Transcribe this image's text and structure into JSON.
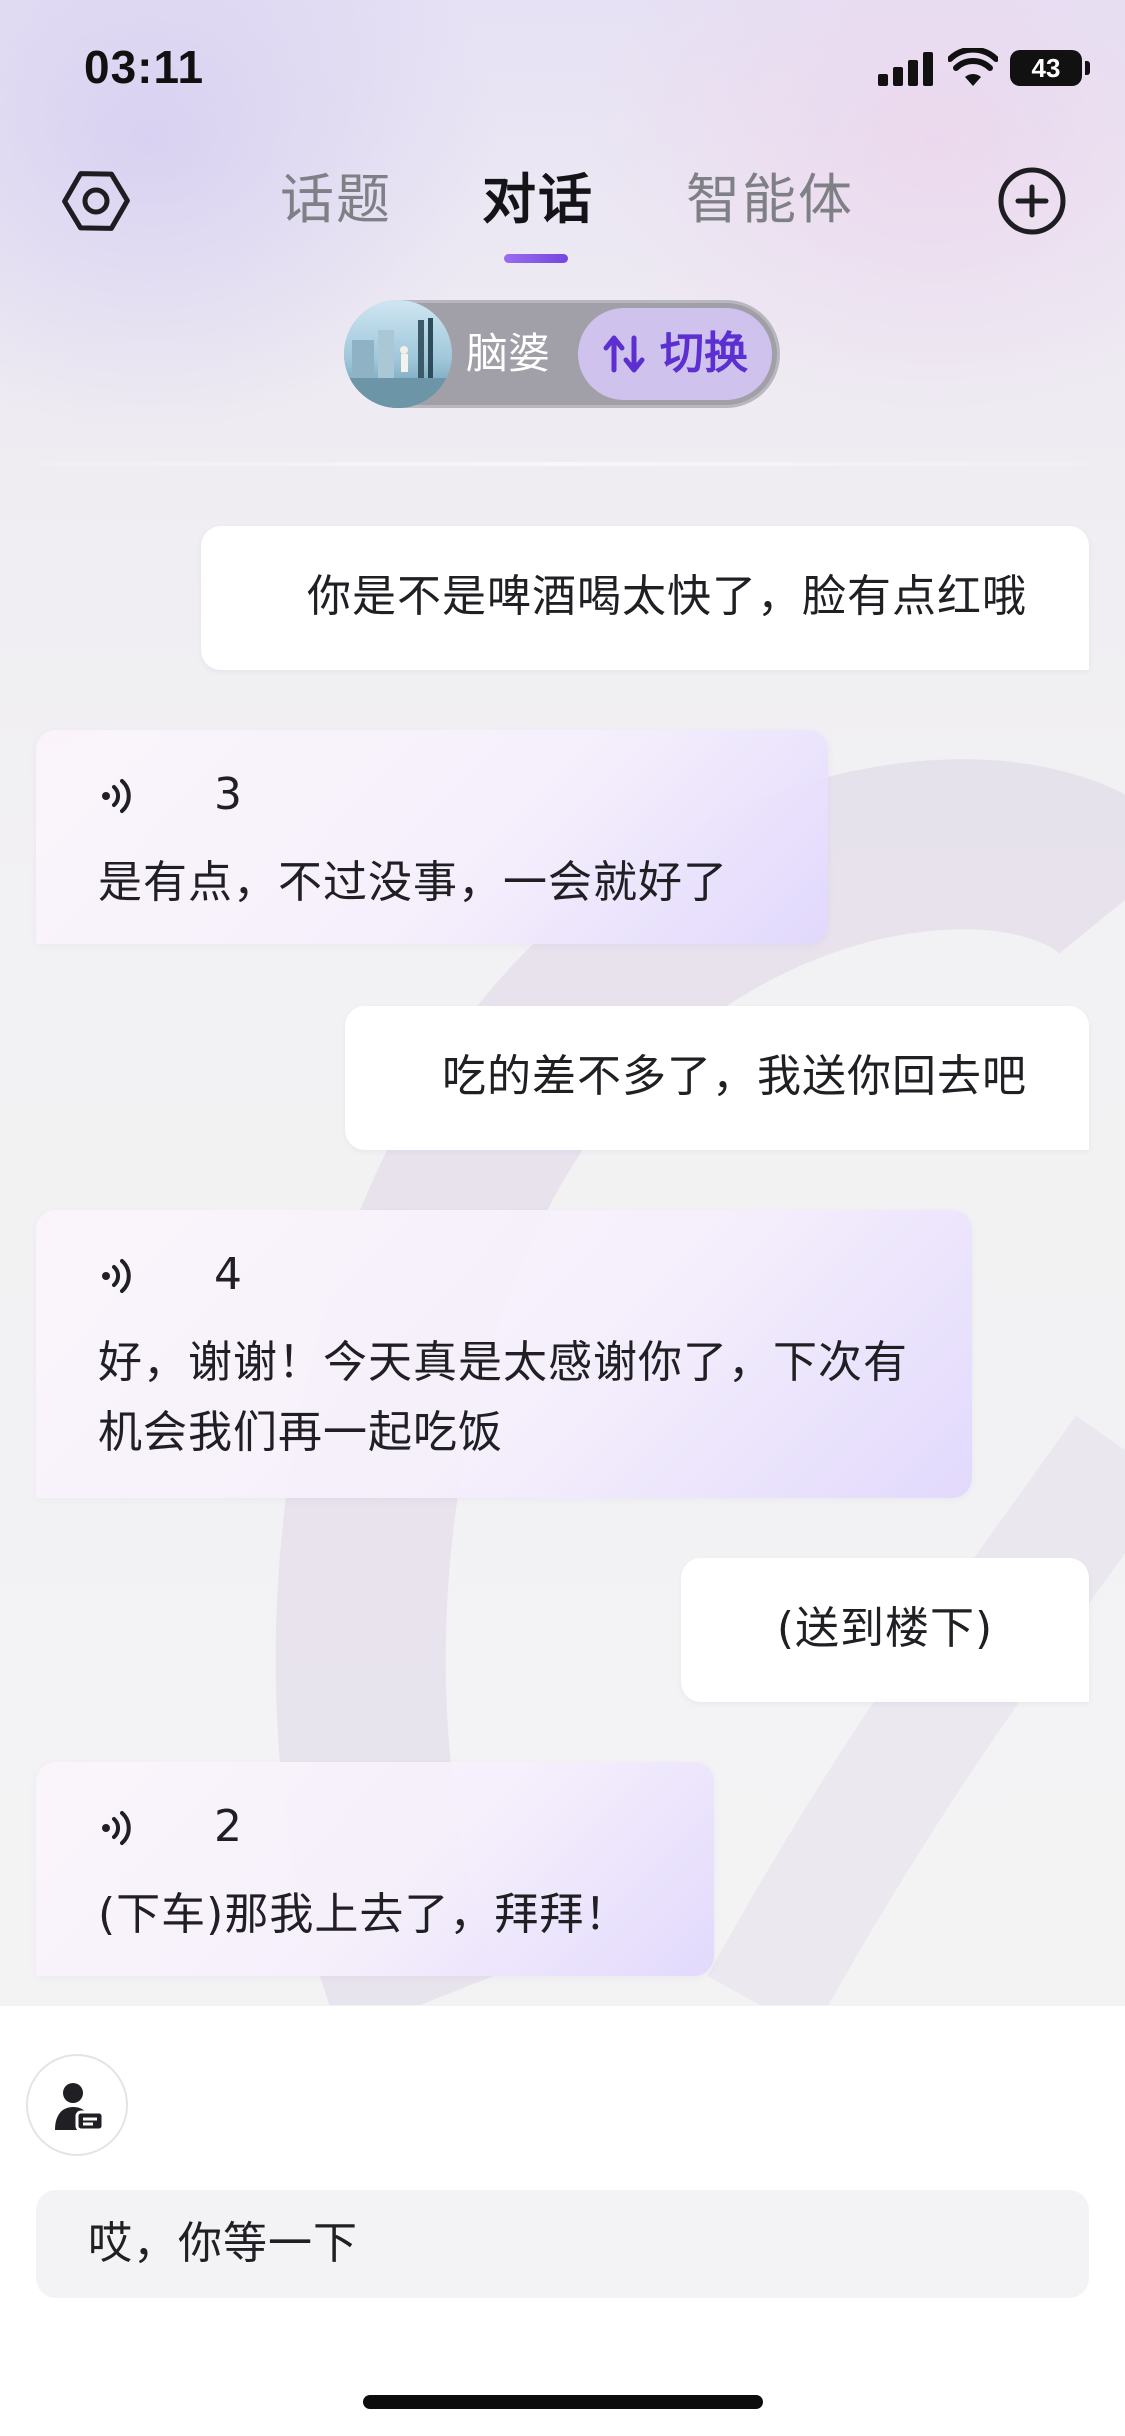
{
  "status_bar": {
    "time": "03:11",
    "battery": "43",
    "icons": [
      "signal-icon",
      "wifi-icon",
      "battery-icon"
    ]
  },
  "nav": {
    "settings_icon": "settings-hexagon-icon",
    "tabs": [
      {
        "label": "话题",
        "active": false
      },
      {
        "label": "对话",
        "active": true
      },
      {
        "label": "智能体",
        "active": false
      }
    ],
    "add_icon": "plus-circle-icon",
    "accent_color": "#7447df"
  },
  "character": {
    "name": "脑婆",
    "switch_label": "切换",
    "switch_icon": "swap-arrows-icon"
  },
  "messages": [
    {
      "role": "user",
      "text": "你是不是啤酒喝太快了，脸有点红哦"
    },
    {
      "role": "ai",
      "voice_count": "3",
      "text": "是有点，不过没事，一会就好了"
    },
    {
      "role": "user",
      "text": "吃的差不多了，我送你回去吧"
    },
    {
      "role": "ai",
      "voice_count": "4",
      "text": "好，谢谢！今天真是太感谢你了，下次有机会我们再一起吃饭"
    },
    {
      "role": "user",
      "text": "(送到楼下)"
    },
    {
      "role": "ai",
      "voice_count": "2",
      "text": "(下车)那我上去了，拜拜！"
    }
  ],
  "composer": {
    "mode_icon": "persona-card-icon",
    "input_value": "哎，你等一下"
  }
}
